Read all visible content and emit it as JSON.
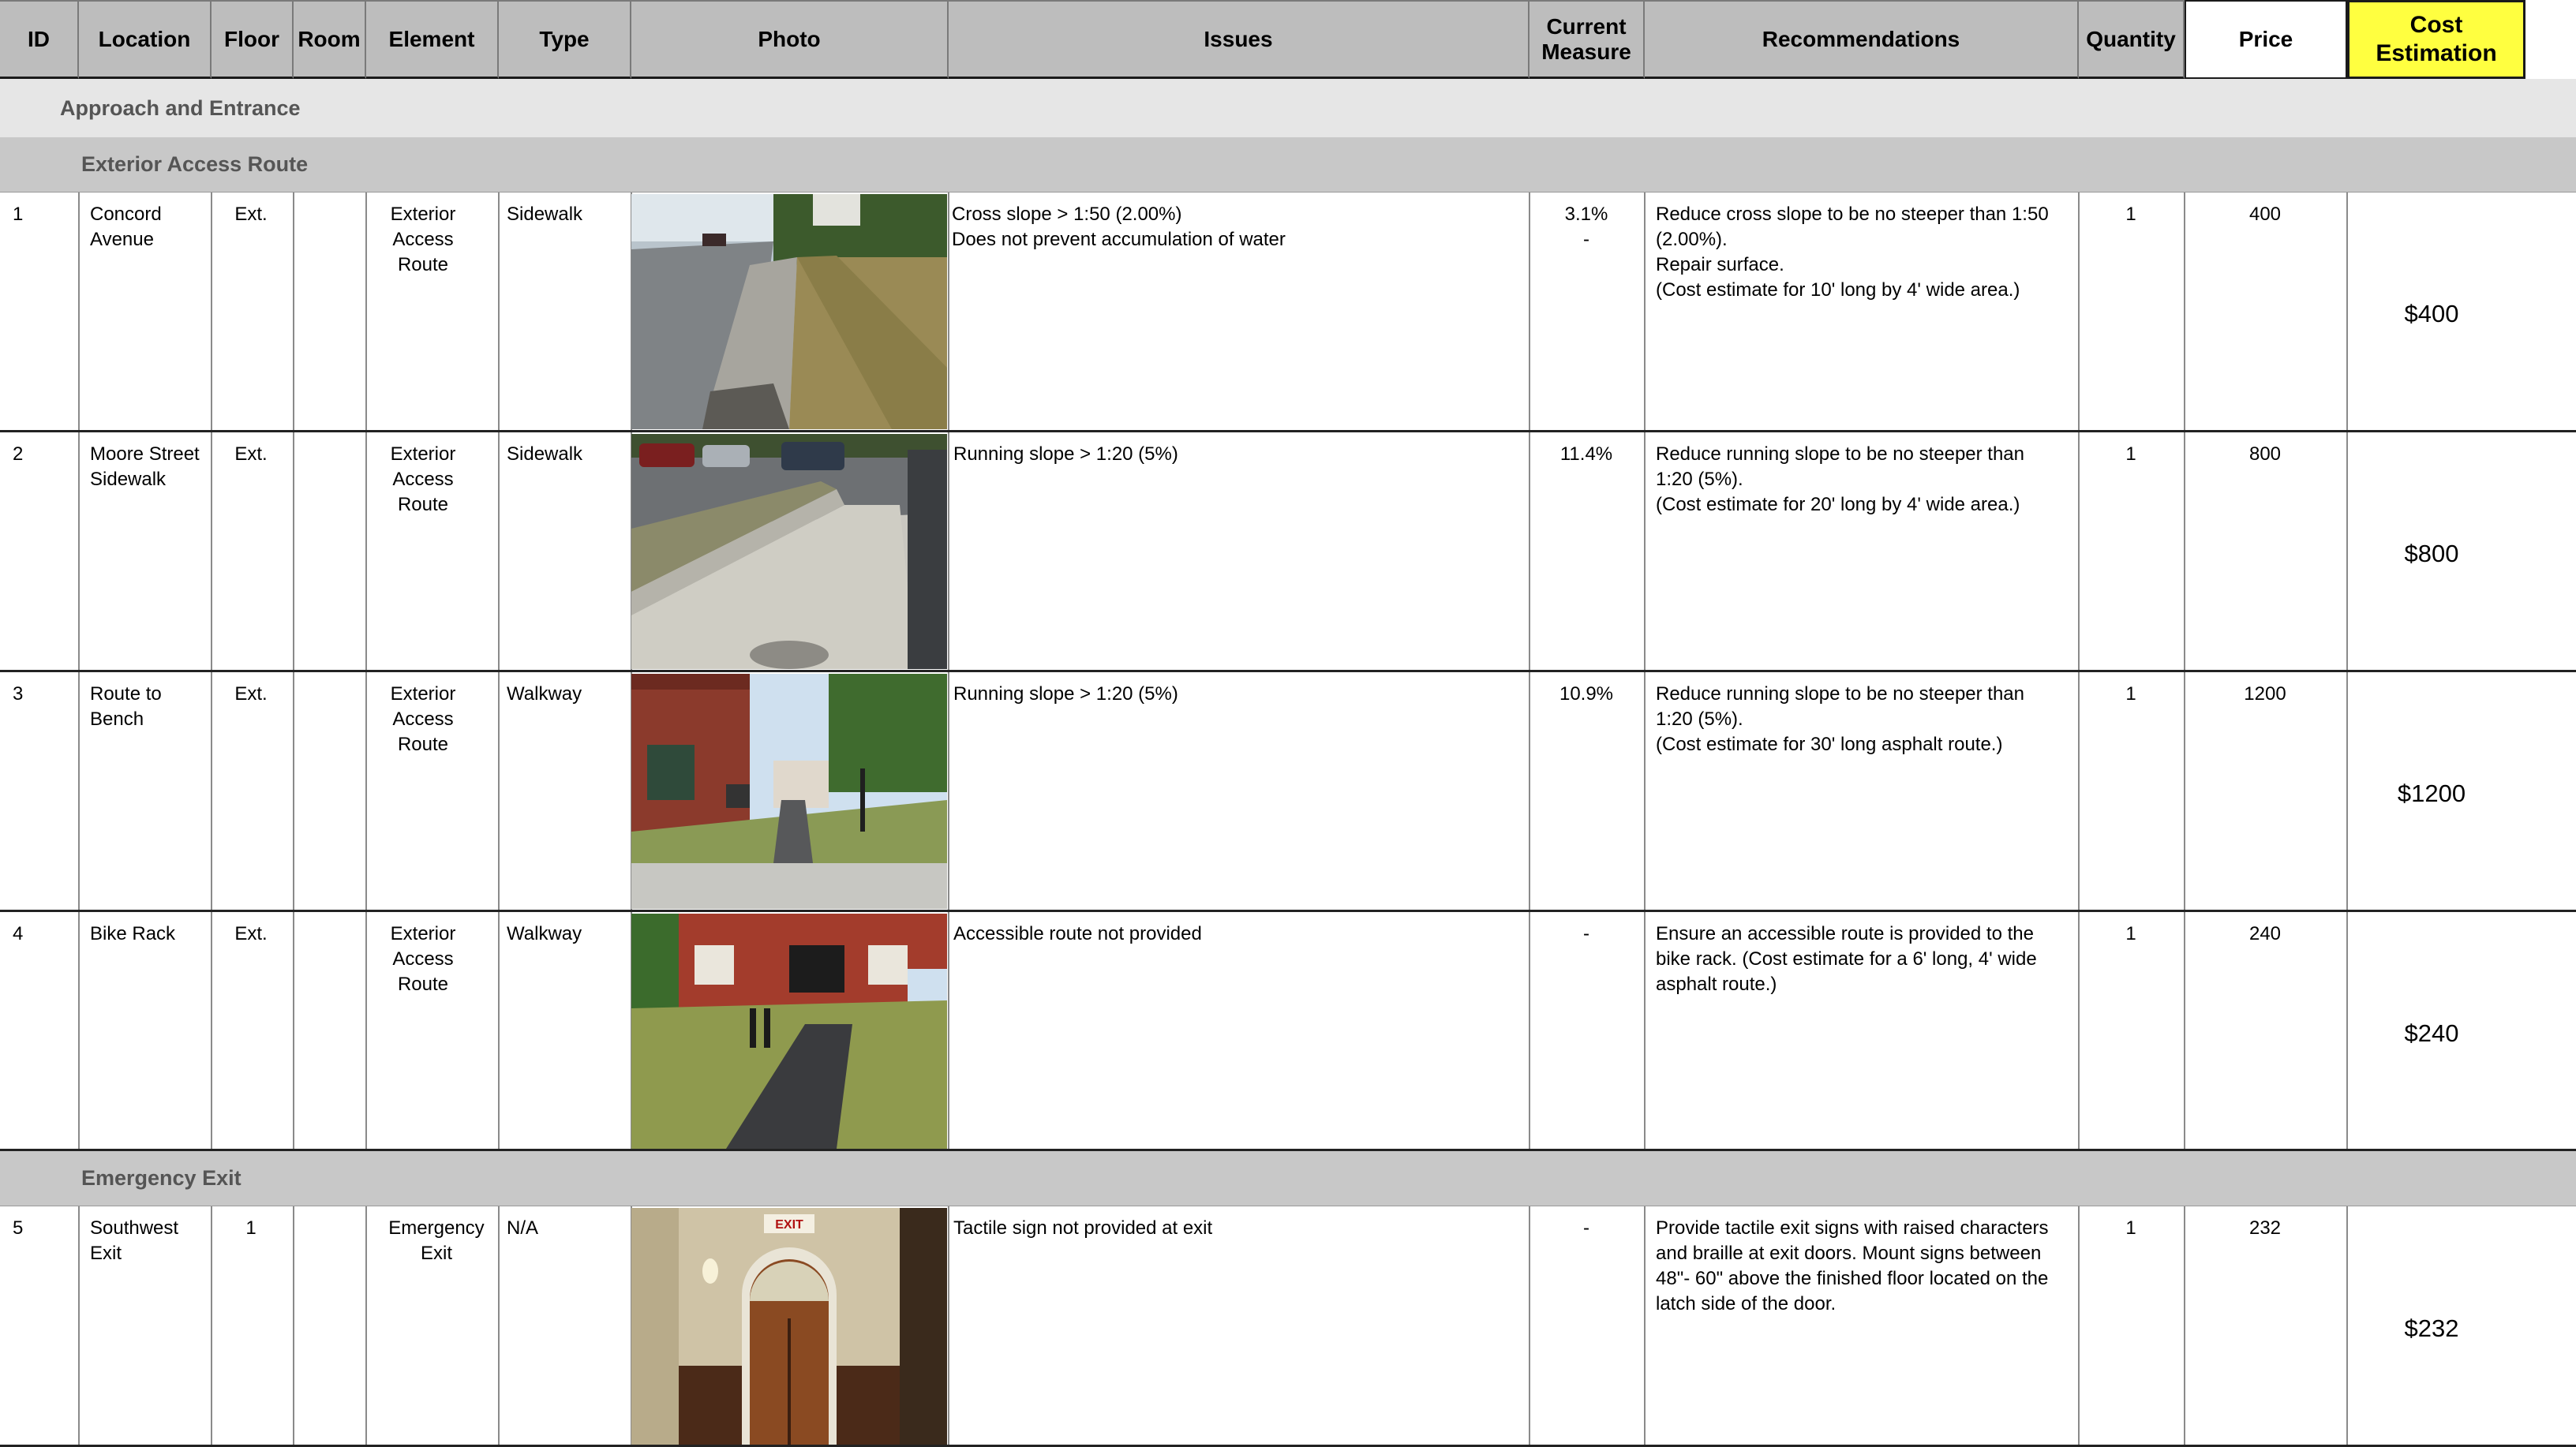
{
  "headers": {
    "id": "ID",
    "location": "Location",
    "floor": "Floor",
    "room": "Room",
    "element": "Element",
    "type": "Type",
    "photo": "Photo",
    "issues": "Issues",
    "current_measure": "Current\nMeasure",
    "recommendations": "Recommendations",
    "quantity": "Quantity",
    "price": "Price",
    "cost_estimation": "Cost\nEstimation"
  },
  "section": "Approach and Entrance",
  "groups": [
    {
      "title": "Exterior Access Route",
      "rows": [
        {
          "id": "1",
          "location": "Concord\nAvenue",
          "floor": "Ext.",
          "room": "",
          "element": "Exterior\nAccess\nRoute",
          "type": "Sidewalk",
          "issues": " Cross slope > 1:50 (2.00%)\nDoes not prevent accumulation of water",
          "measure": "3.1%\n-",
          "recommendations": "Reduce cross slope to be no steeper than 1:50\n(2.00%).\nRepair surface.\n(Cost estimate for 10' long by 4' wide area.)",
          "quantity": "1",
          "price": "400",
          "cost": "$400"
        },
        {
          "id": "2",
          "location": "Moore Street\nSidewalk",
          "floor": "Ext.",
          "room": "",
          "element": "Exterior\nAccess\nRoute",
          "type": "Sidewalk",
          "issues": "Running slope > 1:20 (5%)",
          "measure": "11.4%",
          "recommendations": "Reduce running slope to be no steeper than\n1:20 (5%).\n(Cost estimate for 20' long by 4' wide area.)",
          "quantity": "1",
          "price": "800",
          "cost": "$800"
        },
        {
          "id": "3",
          "location": "Route to\nBench",
          "floor": "Ext.",
          "room": "",
          "element": "Exterior\nAccess\nRoute",
          "type": "Walkway",
          "issues": "Running slope > 1:20 (5%)",
          "measure": "10.9%",
          "recommendations": "Reduce running slope to be no steeper than\n1:20 (5%).\n(Cost estimate for 30' long asphalt route.)",
          "quantity": "1",
          "price": "1200",
          "cost": "$1200"
        },
        {
          "id": "4",
          "location": "Bike Rack",
          "floor": "Ext.",
          "room": "",
          "element": "Exterior\nAccess\nRoute",
          "type": "Walkway",
          "issues": "Accessible route not provided",
          "measure": "-",
          "recommendations": "Ensure an accessible route is provided to the\nbike rack. (Cost estimate for a 6' long, 4' wide\nasphalt route.)",
          "quantity": "1",
          "price": "240",
          "cost": "$240"
        }
      ]
    },
    {
      "title": "Emergency Exit",
      "rows": [
        {
          "id": "5",
          "location": "Southwest\nExit",
          "floor": "1",
          "room": "",
          "element": "Emergency\nExit",
          "type": "N/A",
          "issues": "Tactile sign not provided at exit",
          "measure": "-",
          "recommendations": "Provide tactile exit signs with raised characters\nand braille at exit doors. Mount signs between\n48\"- 60\" above the finished floor located on the\nlatch side of the door.",
          "quantity": "1",
          "price": "232",
          "cost": "$232",
          "sign_text": "EXIT"
        }
      ]
    }
  ],
  "colors": {
    "header_bg": "#bdbdbd",
    "cost_header_bg": "#ffff40",
    "section_bg": "#e6e6e6",
    "group_bg": "#c8c8c8"
  }
}
